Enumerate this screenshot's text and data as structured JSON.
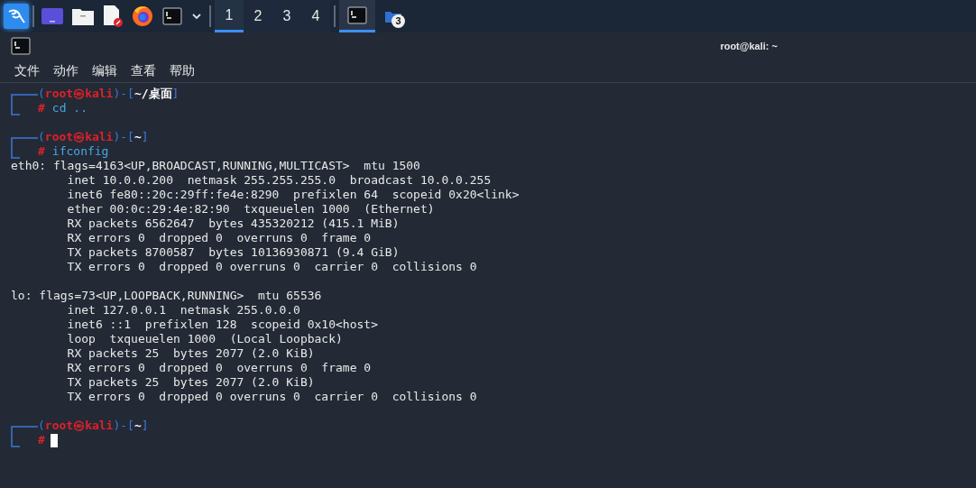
{
  "taskbar": {
    "workspaces": [
      {
        "label": "1",
        "selected": true
      },
      {
        "label": "2",
        "selected": false
      },
      {
        "label": "3",
        "selected": false
      },
      {
        "label": "4",
        "selected": false
      }
    ],
    "tasks": [
      {
        "kind": "terminal",
        "selected": true
      },
      {
        "kind": "folder",
        "selected": false,
        "badge": "3"
      }
    ]
  },
  "window": {
    "title": "root@kali: ~"
  },
  "menu": [
    "文件",
    "动作",
    "编辑",
    "查看",
    "帮助"
  ],
  "terminal": {
    "blocks": [
      {
        "kind": "prompt",
        "open": "(",
        "identity": "root㉿kali",
        "separator": ")-[",
        "path": "~/桌面",
        "close": "]",
        "marker": "#",
        "command": "cd ..",
        "cursor": false
      },
      {
        "kind": "prompt",
        "open": "(",
        "identity": "root㉿kali",
        "separator": ")-[",
        "path": "~",
        "close": "]",
        "marker": "#",
        "command": "ifconfig",
        "cursor": false
      },
      {
        "kind": "output",
        "lines": [
          "eth0: flags=4163<UP,BROADCAST,RUNNING,MULTICAST>  mtu 1500",
          "        inet 10.0.0.200  netmask 255.255.255.0  broadcast 10.0.0.255",
          "        inet6 fe80::20c:29ff:fe4e:8290  prefixlen 64  scopeid 0x20<link>",
          "        ether 00:0c:29:4e:82:90  txqueuelen 1000  (Ethernet)",
          "        RX packets 6562647  bytes 435320212 (415.1 MiB)",
          "        RX errors 0  dropped 0  overruns 0  frame 0",
          "        TX packets 8700587  bytes 10136930871 (9.4 GiB)",
          "        TX errors 0  dropped 0 overruns 0  carrier 0  collisions 0"
        ]
      },
      {
        "kind": "output",
        "lines": [
          "lo: flags=73<UP,LOOPBACK,RUNNING>  mtu 65536",
          "        inet 127.0.0.1  netmask 255.0.0.0",
          "        inet6 ::1  prefixlen 128  scopeid 0x10<host>",
          "        loop  txqueuelen 1000  (Local Loopback)",
          "        RX packets 25  bytes 2077 (2.0 KiB)",
          "        RX errors 0  dropped 0  overruns 0  frame 0",
          "        TX packets 25  bytes 2077 (2.0 KiB)",
          "        TX errors 0  dropped 0 overruns 0  carrier 0  collisions 0"
        ]
      },
      {
        "kind": "prompt",
        "open": "(",
        "identity": "root㉿kali",
        "separator": ")-[",
        "path": "~",
        "close": "]",
        "marker": "#",
        "cursor": true
      }
    ]
  }
}
